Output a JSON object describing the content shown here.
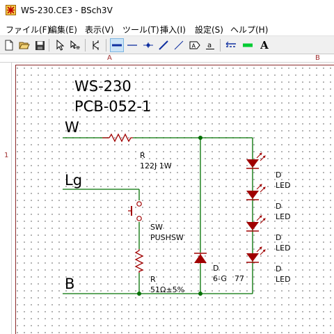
{
  "window": {
    "title": "WS-230.CE3 - BSch3V"
  },
  "menu": [
    {
      "label": "ファイル(F)"
    },
    {
      "label": "編集(E)"
    },
    {
      "label": "表示(V)"
    },
    {
      "label": "ツール(T)"
    },
    {
      "label": "挿入(I)"
    },
    {
      "label": "設定(S)"
    },
    {
      "label": "ヘルプ(H)"
    }
  ],
  "toolbar": {
    "buttons": [
      {
        "icon": "new-file-icon"
      },
      {
        "icon": "open-folder-icon"
      },
      {
        "icon": "save-disk-icon"
      },
      {
        "icon": "select-arrow-icon"
      },
      {
        "icon": "drag-select-icon"
      },
      {
        "icon": "component-icon"
      },
      {
        "icon": "wire-icon",
        "active": true
      },
      {
        "icon": "bus-icon"
      },
      {
        "icon": "junction-icon"
      },
      {
        "icon": "entry-icon"
      },
      {
        "icon": "dash-line-icon"
      },
      {
        "icon": "tag-icon"
      },
      {
        "icon": "label-icon"
      },
      {
        "icon": "comment-icon"
      },
      {
        "icon": "marker-icon"
      },
      {
        "icon": "text-icon",
        "glyph": "A"
      }
    ]
  },
  "rulers": {
    "columns": [
      "A",
      "B"
    ],
    "rows": [
      "1"
    ]
  },
  "schematic": {
    "title_lines": [
      "WS-230",
      "PCB-052-1"
    ],
    "net_labels": {
      "w": "W",
      "lg": "Lg",
      "b": "B"
    },
    "components": {
      "r1": {
        "ref": "R",
        "value": "122J 1W"
      },
      "sw": {
        "ref": "SW",
        "value": "PUSHSW"
      },
      "r2": {
        "ref": "R",
        "value": "51Ω±5%"
      },
      "d": {
        "ref": "D",
        "value": "6-G",
        "extra": "77"
      },
      "leds": [
        {
          "ref": "D",
          "value": "LED"
        },
        {
          "ref": "D",
          "value": "LED"
        },
        {
          "ref": "D",
          "value": "LED"
        },
        {
          "ref": "D",
          "value": "LED"
        }
      ]
    },
    "colors": {
      "wire": "#007000",
      "part": "#a00000",
      "junction": "#007000",
      "text": "#000000",
      "ruler_text": "#a03030"
    }
  }
}
